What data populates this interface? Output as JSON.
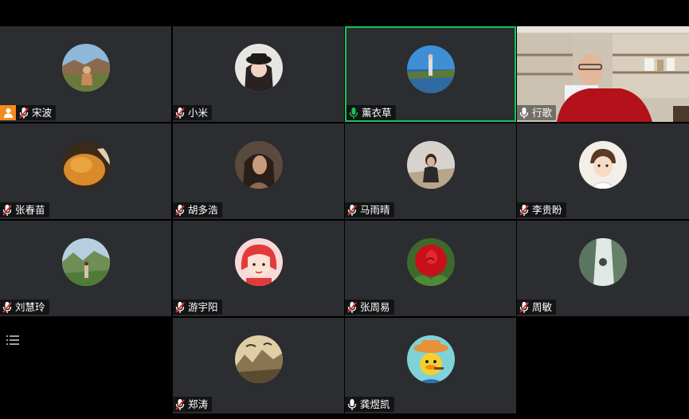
{
  "participants": [
    {
      "name": "宋波",
      "mic": "muted",
      "host": true,
      "avatar": "photo-landscape-person-icon",
      "active": false,
      "video": false
    },
    {
      "name": "小米",
      "mic": "muted",
      "host": false,
      "avatar": "photo-girl-hat-icon",
      "active": false,
      "video": false
    },
    {
      "name": "薰衣草",
      "mic": "speaking",
      "host": false,
      "avatar": "photo-lake-person-icon",
      "active": true,
      "video": false
    },
    {
      "name": "行歌",
      "mic": "on",
      "host": false,
      "avatar": "camera-video-feed",
      "active": false,
      "video": true
    },
    {
      "name": "张春苗",
      "mic": "muted",
      "host": false,
      "avatar": "photo-bread-icon",
      "active": false,
      "video": false
    },
    {
      "name": "胡多浩",
      "mic": "muted",
      "host": false,
      "avatar": "photo-woman-hair-icon",
      "active": false,
      "video": false
    },
    {
      "name": "马雨晴",
      "mic": "muted",
      "host": false,
      "avatar": "photo-desert-woman-icon",
      "active": false,
      "video": false
    },
    {
      "name": "李贵盼",
      "mic": "muted",
      "host": false,
      "avatar": "cartoon-boy-icon",
      "active": false,
      "video": false
    },
    {
      "name": "刘慧玲",
      "mic": "muted",
      "host": false,
      "avatar": "photo-green-valley-icon",
      "active": false,
      "video": false
    },
    {
      "name": "游宇阳",
      "mic": "muted",
      "host": false,
      "avatar": "cartoon-red-girl-icon",
      "active": false,
      "video": false
    },
    {
      "name": "张周易",
      "mic": "muted",
      "host": false,
      "avatar": "red-rose-icon",
      "active": false,
      "video": false
    },
    {
      "name": "周敏",
      "mic": "muted",
      "host": false,
      "avatar": "photo-waterfall-icon",
      "active": false,
      "video": false
    },
    {
      "name": "郑涛",
      "mic": "muted",
      "host": false,
      "avatar": "ink-landscape-painting-icon",
      "active": false,
      "video": false
    },
    {
      "name": "龚煜凯",
      "mic": "on",
      "host": false,
      "avatar": "cartoon-duck-hat-icon",
      "active": false,
      "video": false
    }
  ],
  "colors": {
    "tile": "#2b2d30",
    "active_border": "#15c35a",
    "speaking_mic": "#15c35a",
    "muted_slash": "#e0342b",
    "host_badge": "#f38b1e"
  }
}
